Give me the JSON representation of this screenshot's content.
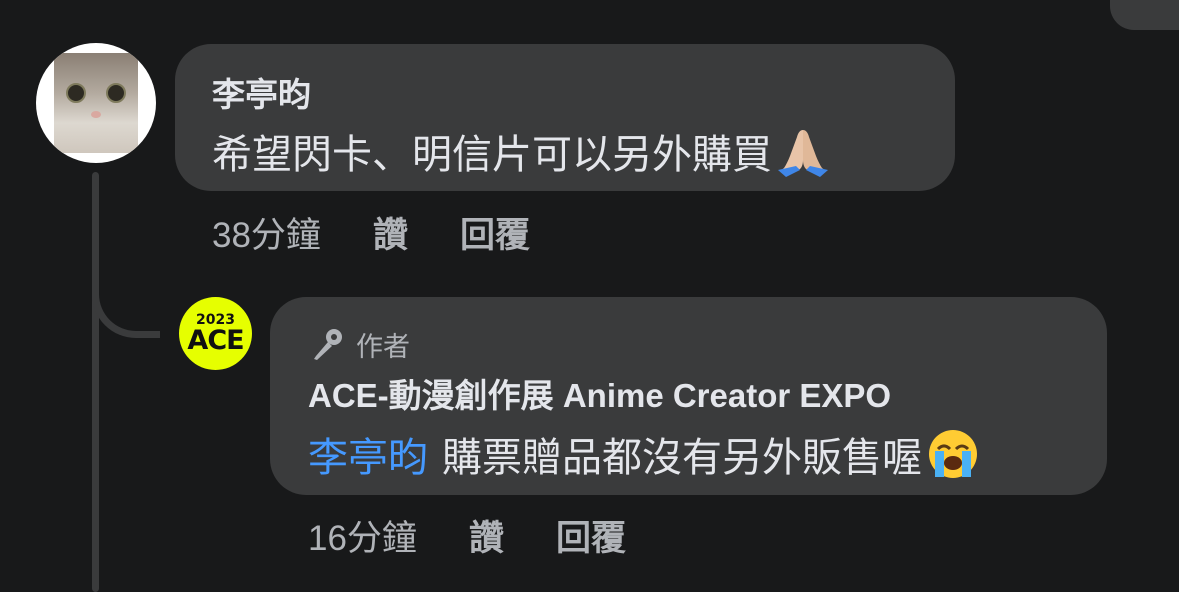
{
  "comment": {
    "author": "李亭昀",
    "text": "希望閃卡、明信片可以另外購買",
    "emoji": "folded-hands-emoji",
    "time": "38分鐘",
    "like_label": "讚",
    "reply_label": "回覆"
  },
  "reply": {
    "badge": "作者",
    "badge_icon": "microphone-icon",
    "author": "ACE-動漫創作展 Anime Creator EXPO",
    "mention": "李亭昀",
    "text": "購票贈品都沒有另外販售喔",
    "emoji": "loudly-crying-face-emoji",
    "time": "16分鐘",
    "like_label": "讚",
    "reply_label": "回覆",
    "logo_year": "2023",
    "logo_text": "ACE"
  },
  "colors": {
    "background": "#18191a",
    "bubble": "#3a3b3c",
    "text": "#e4e6eb",
    "secondary_text": "#b0b3b8",
    "mention": "#4599ff",
    "logo": "#e6ff00"
  }
}
